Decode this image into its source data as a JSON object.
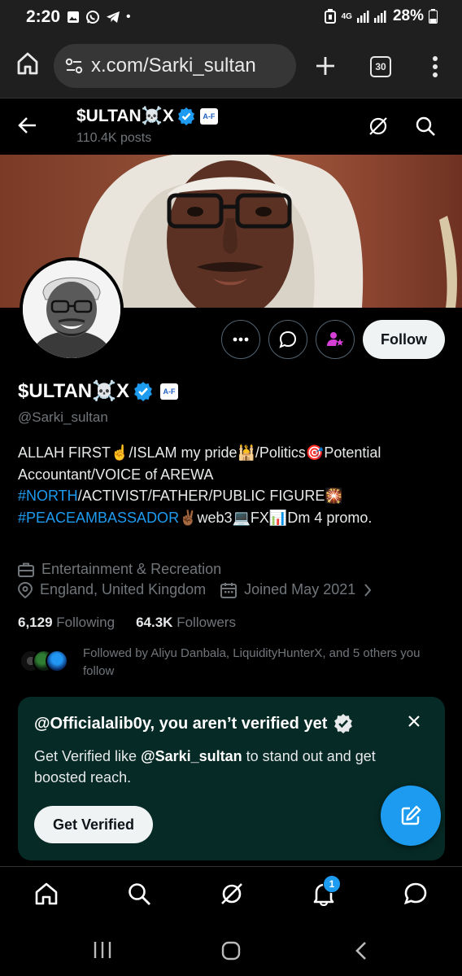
{
  "status_bar": {
    "time": "2:20",
    "dot": "•",
    "network": "4G",
    "battery": "28%",
    "icons": [
      "gallery-icon",
      "whatsapp-icon",
      "telegram-icon",
      "alarm-icon",
      "signal-icon",
      "battery-icon"
    ]
  },
  "browser": {
    "url": "x.com/Sarki_sultan",
    "tab_count": "30"
  },
  "header": {
    "name": "$ULTAN☠️X",
    "posts": "110.4K posts",
    "affiliate_badge": "A-F"
  },
  "profile": {
    "name": "$ULTAN☠️X",
    "handle": "@Sarki_sultan",
    "follow_label": "Follow",
    "bio": {
      "line1": "ALLAH FIRST☝️/ISLAM my pride🕌/Politics🎯Potential Accountant/VOICE of AREWA",
      "tag_north": "#NORTH",
      "mid": "/ACTIVIST/FATHER/PUBLIC FIGURE🎇",
      "tag_peace": "#PEACEAMBASSADOR",
      "end": "✌🏾web3💻FX📊Dm 4 promo."
    },
    "category": "Entertainment & Recreation",
    "location": "England, United Kingdom",
    "joined": "Joined May 2021",
    "following_count": "6,129",
    "following_label": "Following",
    "followers_count": "64.3K",
    "followers_label": "Followers",
    "followed_by": "Followed by Aliyu Danbala, LiquidityHunterX, and 5 others you follow"
  },
  "verify_card": {
    "title": "@Officialalib0y, you aren’t verified yet",
    "desc_prefix": "Get Verified like ",
    "desc_handle": "@Sarki_sultan",
    "desc_suffix": " to stand out and get boosted reach.",
    "button": "Get Verified"
  },
  "bottom_nav": {
    "notification_badge": "1",
    "items": [
      "home-icon",
      "search-icon",
      "grok-icon",
      "notifications-icon",
      "messages-icon"
    ]
  },
  "colors": {
    "accent": "#1d9bf0",
    "card_bg": "#062a25",
    "muted": "#71767b"
  }
}
